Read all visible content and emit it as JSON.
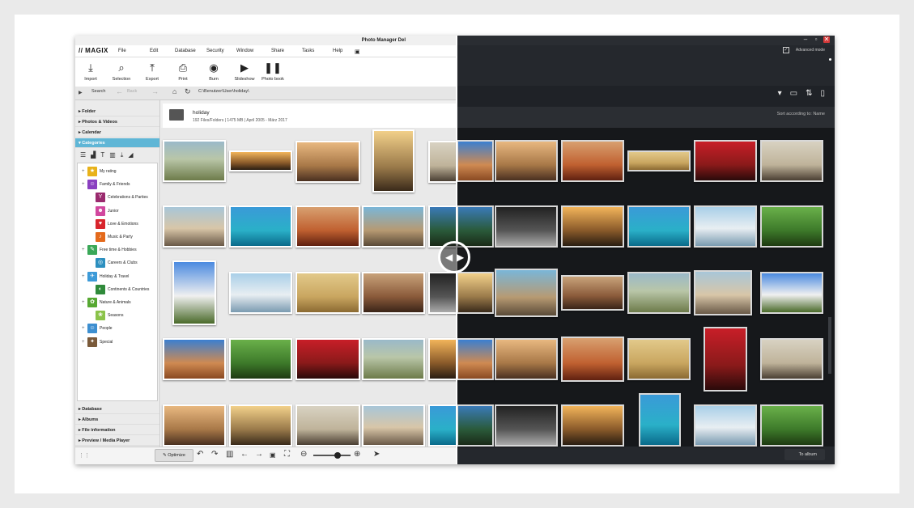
{
  "window": {
    "title": "Photo Manager Del",
    "min_glyph": "–",
    "max_glyph": "▫",
    "close_glyph": "✕"
  },
  "menu": {
    "logo": "MAGIX",
    "items": [
      "File",
      "Edit",
      "Database",
      "Security",
      "Window",
      "Share",
      "Tasks",
      "Help"
    ]
  },
  "toolbar": {
    "buttons": [
      {
        "label": "Import",
        "icon": "import-icon"
      },
      {
        "label": "Selection",
        "icon": "magnifier-icon"
      },
      {
        "label": "Export",
        "icon": "export-icon"
      },
      {
        "label": "Print",
        "icon": "printer-icon"
      },
      {
        "label": "Burn",
        "icon": "disc-icon"
      },
      {
        "label": "Slideshow",
        "icon": "play-icon"
      },
      {
        "label": "Photo book",
        "icon": "book-icon"
      }
    ]
  },
  "pathbar": {
    "search_label": "Search",
    "back_label": "Back",
    "path": "C:\\Benutzer\\User\\holiday\\"
  },
  "sidebar": {
    "sections_top": [
      "Folder",
      "Photos & Videos",
      "Calendar",
      "Categories"
    ],
    "sections_bottom": [
      "Database",
      "Albums",
      "File information",
      "Preview / Media Player"
    ],
    "tree": [
      {
        "label": "My rating",
        "color": "#e8b21a",
        "level": 0
      },
      {
        "label": "Family & Friends",
        "color": "#8a3fc0",
        "level": 0
      },
      {
        "label": "Celebrations & Parties",
        "color": "#9a2a6e",
        "level": 1
      },
      {
        "label": "Junior",
        "color": "#d1479e",
        "level": 1
      },
      {
        "label": "Love & Emotions",
        "color": "#d8252c",
        "level": 1
      },
      {
        "label": "Music & Party",
        "color": "#e46a1c",
        "level": 1
      },
      {
        "label": "Free time & Hobbies",
        "color": "#3aa858",
        "level": 0
      },
      {
        "label": "Careers & Clubs",
        "color": "#2c8fbf",
        "level": 1
      },
      {
        "label": "Holiday & Travel",
        "color": "#3c9ad8",
        "level": 0
      },
      {
        "label": "Continents & Countries",
        "color": "#2f8a3a",
        "level": 1
      },
      {
        "label": "Nature & Animals",
        "color": "#56a832",
        "level": 0
      },
      {
        "label": "Seasons",
        "color": "#8bc34a",
        "level": 1
      },
      {
        "label": "People",
        "color": "#3d8fd0",
        "level": 0
      },
      {
        "label": "Special",
        "color": "#7a5a3a",
        "level": 0
      }
    ]
  },
  "folder": {
    "title": "holiday",
    "subtitle": "192 Files/Folders | 1475 MB | April 2005 - März 2017"
  },
  "dark": {
    "advanced_mode": "Advanced mode",
    "sort": "Sort according to: Name",
    "to_album": "To album"
  },
  "bottom": {
    "optimize": "Optimize"
  },
  "colors": {
    "accent": "#5fb6d6",
    "dark_bg": "#16181b",
    "light_bg": "#e9e9e9"
  }
}
